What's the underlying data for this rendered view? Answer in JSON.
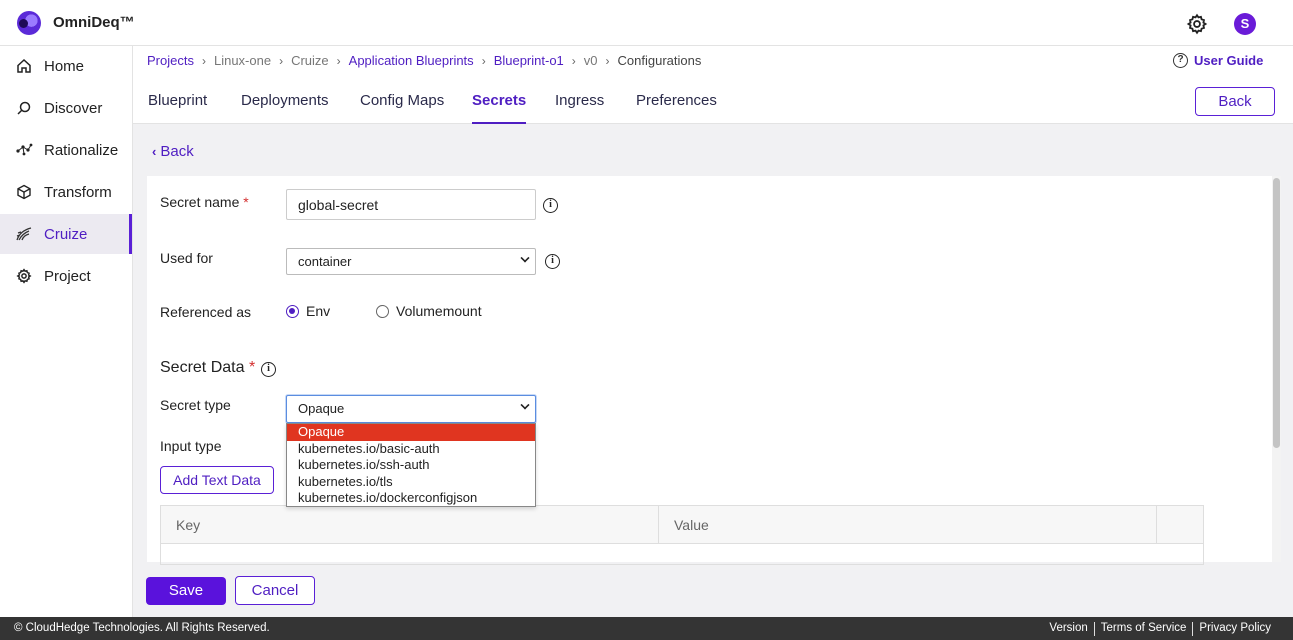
{
  "app": {
    "brand": "OmniDeq™"
  },
  "header": {
    "avatar_letter": "S"
  },
  "sidebar": {
    "items": [
      {
        "label": "Home",
        "icon": "home-icon"
      },
      {
        "label": "Discover",
        "icon": "discover-icon"
      },
      {
        "label": "Rationalize",
        "icon": "rationalize-icon"
      },
      {
        "label": "Transform",
        "icon": "transform-icon"
      },
      {
        "label": "Cruize",
        "icon": "cruize-icon",
        "active": true
      },
      {
        "label": "Project",
        "icon": "project-icon"
      }
    ]
  },
  "breadcrumb": [
    "Projects",
    "Linux-one",
    "Cruize",
    "Application Blueprints",
    "Blueprint-o1",
    "v0",
    "Configurations"
  ],
  "user_guide": "User Guide",
  "tabs": [
    "Blueprint",
    "Deployments",
    "Config Maps",
    "Secrets",
    "Ingress",
    "Preferences"
  ],
  "active_tab": "Secrets",
  "back_button": "Back",
  "back_link": "Back",
  "form": {
    "secret_name_label": "Secret name",
    "required_mark": "*",
    "secret_name_value": "global-secret",
    "used_for_label": "Used for",
    "used_for_value": "container",
    "referenced_as_label": "Referenced as",
    "ref_env": "Env",
    "ref_volumemount": "Volumemount",
    "secret_data_title": "Secret Data",
    "secret_type_label": "Secret type",
    "secret_type_value": "Opaque",
    "secret_type_options": [
      "Opaque",
      "kubernetes.io/basic-auth",
      "kubernetes.io/ssh-auth",
      "kubernetes.io/tls",
      "kubernetes.io/dockerconfigjson"
    ],
    "input_type_label": "Input type",
    "add_text_button": "Add Text Data"
  },
  "table": {
    "columns": [
      "Key",
      "Value"
    ]
  },
  "actions": {
    "save": "Save",
    "cancel": "Cancel"
  },
  "footer": {
    "copyright": "© CloudHedge Technologies. All Rights Reserved.",
    "links": [
      "Version",
      "Terms of Service",
      "Privacy Policy"
    ]
  },
  "colors": {
    "accent": "#4f1ec2",
    "selected_option": "#e03520",
    "footer": "#343434"
  }
}
